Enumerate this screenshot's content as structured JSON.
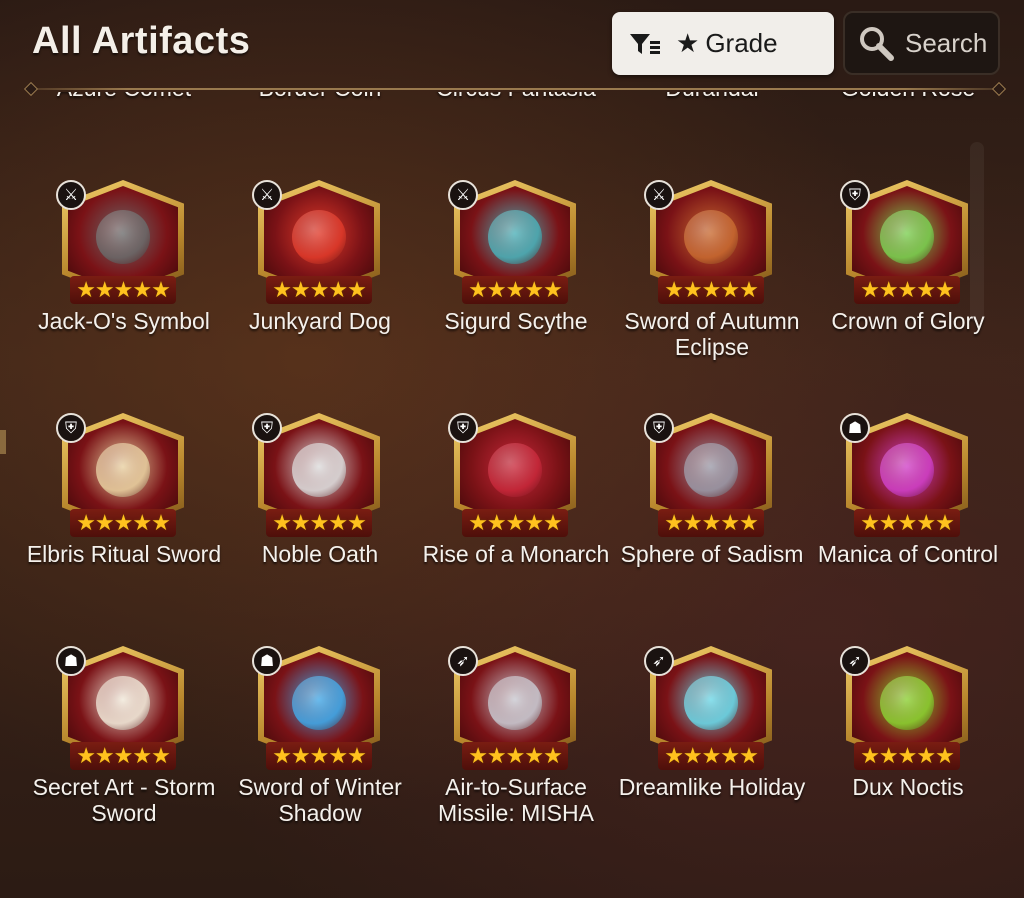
{
  "header": {
    "title": "All Artifacts",
    "grade_label": "Grade",
    "grade_star": "★",
    "search_label": "Search"
  },
  "colors": {
    "gold": "#ffc21e",
    "frame_gold": "#c89a3a",
    "grade_button_bg": "#f1eeea",
    "search_button_bg": "#1e1612"
  },
  "artifacts": [
    {
      "name": "Azure Comet",
      "stars": "★★★★★",
      "class_icon": "",
      "art": "#5fa8e8"
    },
    {
      "name": "Border Coin",
      "stars": "★★★★★",
      "class_icon": "",
      "art": "#e8a030"
    },
    {
      "name": "Circus Fantasia",
      "stars": "★★★★★",
      "class_icon": "",
      "art": "#3a6ad8"
    },
    {
      "name": "Durandal",
      "stars": "★★★★★",
      "class_icon": "",
      "art": "#f0b040"
    },
    {
      "name": "Golden Rose",
      "stars": "★★★★★",
      "class_icon": "",
      "art": "#e0305a"
    },
    {
      "name": "Jack-O's Symbol",
      "stars": "★★★★★",
      "class_icon": "sword-class-icon",
      "art": "#6a6a6a"
    },
    {
      "name": "Junkyard Dog",
      "stars": "★★★★★",
      "class_icon": "sword-class-icon",
      "art": "#e03a2a"
    },
    {
      "name": "Sigurd Scythe",
      "stars": "★★★★★",
      "class_icon": "sword-class-icon",
      "art": "#4ab0b8"
    },
    {
      "name": "Sword of Autumn Eclipse",
      "stars": "★★★★★",
      "class_icon": "sword-class-icon",
      "art": "#c86a30"
    },
    {
      "name": "Crown of Glory",
      "stars": "★★★★★",
      "class_icon": "shield-class-icon",
      "art": "#7ad050"
    },
    {
      "name": "Elbris Ritual Sword",
      "stars": "★★★★★",
      "class_icon": "shield-class-icon",
      "art": "#e8d0a0"
    },
    {
      "name": "Noble Oath",
      "stars": "★★★★★",
      "class_icon": "shield-class-icon",
      "art": "#dcdcdc"
    },
    {
      "name": "Rise of a Monarch",
      "stars": "★★★★★",
      "class_icon": "shield-class-icon",
      "art": "#c8283a"
    },
    {
      "name": "Sphere of Sadism",
      "stars": "★★★★★",
      "class_icon": "shield-class-icon",
      "art": "#9a9aa8"
    },
    {
      "name": "Manica of Control",
      "stars": "★★★★★",
      "class_icon": "hood-class-icon",
      "art": "#d040c8"
    },
    {
      "name": "Secret Art - Storm Sword",
      "stars": "★★★★★",
      "class_icon": "hood-class-icon",
      "art": "#f0e8d8"
    },
    {
      "name": "Sword of Winter Shadow",
      "stars": "★★★★★",
      "class_icon": "hood-class-icon",
      "art": "#40a8e8"
    },
    {
      "name": "Air-to-Surface Missile: MISHA",
      "stars": "★★★★★",
      "class_icon": "bow-class-icon",
      "art": "#c8c8d0"
    },
    {
      "name": "Dreamlike Holiday",
      "stars": "★★★★★",
      "class_icon": "bow-class-icon",
      "art": "#6ad8e8"
    },
    {
      "name": "Dux Noctis",
      "stars": "★★★★★",
      "class_icon": "bow-class-icon",
      "art": "#8ad030"
    }
  ]
}
